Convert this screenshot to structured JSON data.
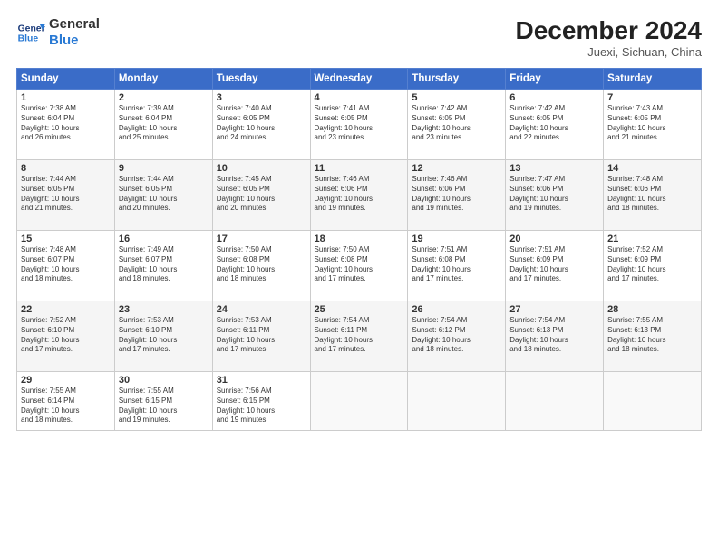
{
  "header": {
    "logo_line1": "General",
    "logo_line2": "Blue",
    "month": "December 2024",
    "location": "Juexi, Sichuan, China"
  },
  "weekdays": [
    "Sunday",
    "Monday",
    "Tuesday",
    "Wednesday",
    "Thursday",
    "Friday",
    "Saturday"
  ],
  "weeks": [
    [
      {
        "day": "1",
        "sunrise": "Sunrise: 7:38 AM",
        "sunset": "Sunset: 6:04 PM",
        "daylight": "Daylight: 10 hours and 26 minutes."
      },
      {
        "day": "2",
        "sunrise": "Sunrise: 7:39 AM",
        "sunset": "Sunset: 6:04 PM",
        "daylight": "Daylight: 10 hours and 25 minutes."
      },
      {
        "day": "3",
        "sunrise": "Sunrise: 7:40 AM",
        "sunset": "Sunset: 6:05 PM",
        "daylight": "Daylight: 10 hours and 24 minutes."
      },
      {
        "day": "4",
        "sunrise": "Sunrise: 7:41 AM",
        "sunset": "Sunset: 6:05 PM",
        "daylight": "Daylight: 10 hours and 23 minutes."
      },
      {
        "day": "5",
        "sunrise": "Sunrise: 7:42 AM",
        "sunset": "Sunset: 6:05 PM",
        "daylight": "Daylight: 10 hours and 23 minutes."
      },
      {
        "day": "6",
        "sunrise": "Sunrise: 7:42 AM",
        "sunset": "Sunset: 6:05 PM",
        "daylight": "Daylight: 10 hours and 22 minutes."
      },
      {
        "day": "7",
        "sunrise": "Sunrise: 7:43 AM",
        "sunset": "Sunset: 6:05 PM",
        "daylight": "Daylight: 10 hours and 21 minutes."
      }
    ],
    [
      {
        "day": "8",
        "sunrise": "Sunrise: 7:44 AM",
        "sunset": "Sunset: 6:05 PM",
        "daylight": "Daylight: 10 hours and 21 minutes."
      },
      {
        "day": "9",
        "sunrise": "Sunrise: 7:44 AM",
        "sunset": "Sunset: 6:05 PM",
        "daylight": "Daylight: 10 hours and 20 minutes."
      },
      {
        "day": "10",
        "sunrise": "Sunrise: 7:45 AM",
        "sunset": "Sunset: 6:05 PM",
        "daylight": "Daylight: 10 hours and 20 minutes."
      },
      {
        "day": "11",
        "sunrise": "Sunrise: 7:46 AM",
        "sunset": "Sunset: 6:06 PM",
        "daylight": "Daylight: 10 hours and 19 minutes."
      },
      {
        "day": "12",
        "sunrise": "Sunrise: 7:46 AM",
        "sunset": "Sunset: 6:06 PM",
        "daylight": "Daylight: 10 hours and 19 minutes."
      },
      {
        "day": "13",
        "sunrise": "Sunrise: 7:47 AM",
        "sunset": "Sunset: 6:06 PM",
        "daylight": "Daylight: 10 hours and 19 minutes."
      },
      {
        "day": "14",
        "sunrise": "Sunrise: 7:48 AM",
        "sunset": "Sunset: 6:06 PM",
        "daylight": "Daylight: 10 hours and 18 minutes."
      }
    ],
    [
      {
        "day": "15",
        "sunrise": "Sunrise: 7:48 AM",
        "sunset": "Sunset: 6:07 PM",
        "daylight": "Daylight: 10 hours and 18 minutes."
      },
      {
        "day": "16",
        "sunrise": "Sunrise: 7:49 AM",
        "sunset": "Sunset: 6:07 PM",
        "daylight": "Daylight: 10 hours and 18 minutes."
      },
      {
        "day": "17",
        "sunrise": "Sunrise: 7:50 AM",
        "sunset": "Sunset: 6:08 PM",
        "daylight": "Daylight: 10 hours and 18 minutes."
      },
      {
        "day": "18",
        "sunrise": "Sunrise: 7:50 AM",
        "sunset": "Sunset: 6:08 PM",
        "daylight": "Daylight: 10 hours and 17 minutes."
      },
      {
        "day": "19",
        "sunrise": "Sunrise: 7:51 AM",
        "sunset": "Sunset: 6:08 PM",
        "daylight": "Daylight: 10 hours and 17 minutes."
      },
      {
        "day": "20",
        "sunrise": "Sunrise: 7:51 AM",
        "sunset": "Sunset: 6:09 PM",
        "daylight": "Daylight: 10 hours and 17 minutes."
      },
      {
        "day": "21",
        "sunrise": "Sunrise: 7:52 AM",
        "sunset": "Sunset: 6:09 PM",
        "daylight": "Daylight: 10 hours and 17 minutes."
      }
    ],
    [
      {
        "day": "22",
        "sunrise": "Sunrise: 7:52 AM",
        "sunset": "Sunset: 6:10 PM",
        "daylight": "Daylight: 10 hours and 17 minutes."
      },
      {
        "day": "23",
        "sunrise": "Sunrise: 7:53 AM",
        "sunset": "Sunset: 6:10 PM",
        "daylight": "Daylight: 10 hours and 17 minutes."
      },
      {
        "day": "24",
        "sunrise": "Sunrise: 7:53 AM",
        "sunset": "Sunset: 6:11 PM",
        "daylight": "Daylight: 10 hours and 17 minutes."
      },
      {
        "day": "25",
        "sunrise": "Sunrise: 7:54 AM",
        "sunset": "Sunset: 6:11 PM",
        "daylight": "Daylight: 10 hours and 17 minutes."
      },
      {
        "day": "26",
        "sunrise": "Sunrise: 7:54 AM",
        "sunset": "Sunset: 6:12 PM",
        "daylight": "Daylight: 10 hours and 18 minutes."
      },
      {
        "day": "27",
        "sunrise": "Sunrise: 7:54 AM",
        "sunset": "Sunset: 6:13 PM",
        "daylight": "Daylight: 10 hours and 18 minutes."
      },
      {
        "day": "28",
        "sunrise": "Sunrise: 7:55 AM",
        "sunset": "Sunset: 6:13 PM",
        "daylight": "Daylight: 10 hours and 18 minutes."
      }
    ],
    [
      {
        "day": "29",
        "sunrise": "Sunrise: 7:55 AM",
        "sunset": "Sunset: 6:14 PM",
        "daylight": "Daylight: 10 hours and 18 minutes."
      },
      {
        "day": "30",
        "sunrise": "Sunrise: 7:55 AM",
        "sunset": "Sunset: 6:15 PM",
        "daylight": "Daylight: 10 hours and 19 minutes."
      },
      {
        "day": "31",
        "sunrise": "Sunrise: 7:56 AM",
        "sunset": "Sunset: 6:15 PM",
        "daylight": "Daylight: 10 hours and 19 minutes."
      },
      null,
      null,
      null,
      null
    ]
  ]
}
